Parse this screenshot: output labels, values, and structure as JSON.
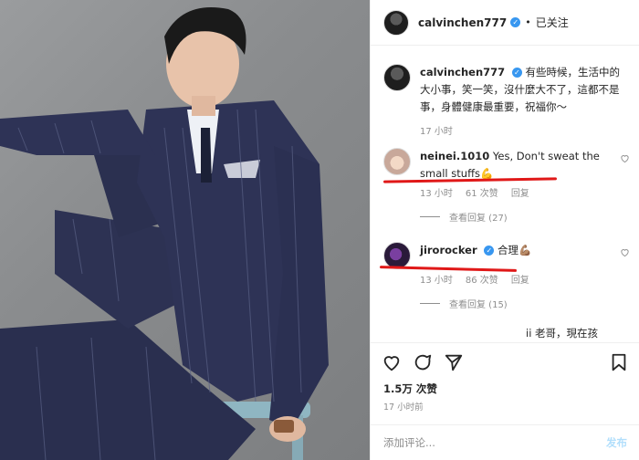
{
  "post": {
    "username": "calvinchen777",
    "follow_status": "已关注",
    "dot": "•",
    "caption": "有些時候，生活中的大小事，笑一笑，沒什麼大不了，這都不是事，身體健康最重要，祝福你～",
    "caption_time": "17 小时"
  },
  "comments": [
    {
      "username": "neinei.1010",
      "text": "Yes, Don't sweat the small stuffs💪",
      "time": "13 小时",
      "likes": "61 次赞",
      "reply": "回复",
      "view_replies": "查看回复 (27)"
    },
    {
      "username": "jirorocker",
      "text": "合理💪🏽",
      "time": "13 小时",
      "likes": "86 次赞",
      "reply": "回复",
      "view_replies": "查看回复 (15)"
    }
  ],
  "partial_comment": "ii 老哥，現在孩",
  "actions": {
    "likes": "1.5万 次赞",
    "post_time": "17 小时前"
  },
  "comment_bar": {
    "placeholder": "添加评论...",
    "post_label": "发布"
  },
  "icons": {
    "heart": "heart-icon",
    "comment": "comment-icon",
    "share": "share-icon",
    "bookmark": "bookmark-icon",
    "verified": "verified-badge-icon"
  },
  "colors": {
    "verified": "#3897f0",
    "annotation": "#e01818",
    "secondary_text": "#8e8e8e"
  }
}
